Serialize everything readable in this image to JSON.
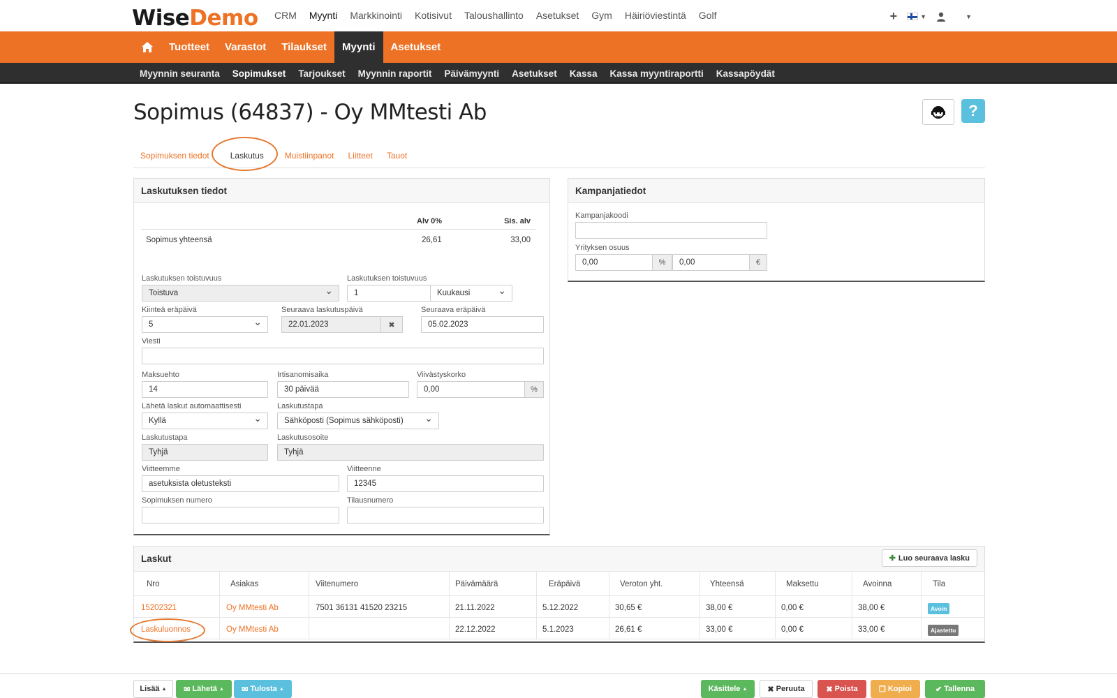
{
  "app": {
    "logo_part1": "Wise",
    "logo_part2": "Demo",
    "brand_color": "#ee7225"
  },
  "top_nav": [
    "CRM",
    "Myynti",
    "Markkinointi",
    "Kotisivut",
    "Taloushallinto",
    "Asetukset",
    "Gym",
    "Häiriöviestintä",
    "Golf"
  ],
  "top_nav_active": "Myynti",
  "main_nav": {
    "items": [
      "Tuotteet",
      "Varastot",
      "Tilaukset",
      "Myynti",
      "Asetukset"
    ],
    "active": "Myynti"
  },
  "sub_nav": {
    "items": [
      "Myynnin seuranta",
      "Sopimukset",
      "Tarjoukset",
      "Myynnin raportit",
      "Päivämyynti",
      "Asetukset",
      "Kassa",
      "Kassa myyntiraportti",
      "Kassapöydät"
    ],
    "active": "Sopimukset"
  },
  "page_title": "Sopimus (64837) - Oy MMtesti Ab",
  "help_label": "?",
  "tabs": [
    "Sopimuksen tiedot",
    "Laskutus",
    "Muistiinpanot",
    "Liitteet",
    "Tauot"
  ],
  "tabs_active": "Laskutus",
  "billing_panel": {
    "title": "Laskutuksen tiedot",
    "col_excl": "Alv 0%",
    "col_incl": "Sis. alv",
    "total_label": "Sopimus yhteensä",
    "total_excl": "26,61",
    "total_incl": "33,00",
    "recurrence_label": "Laskutuksen toistuvuus",
    "recurrence_value": "Toistuva",
    "recurrence2_label": "Laskutuksen toistuvuus",
    "recurrence_count": "1",
    "recurrence_unit": "Kuukausi",
    "fixed_due_label": "Kiinteä eräpäivä",
    "fixed_due_value": "5",
    "next_billing_label": "Seuraava laskutuspäivä",
    "next_billing_value": "22.01.2023",
    "next_due_label": "Seuraava eräpäivä",
    "next_due_value": "05.02.2023",
    "message_label": "Viesti",
    "message_value": "",
    "payment_terms_label": "Maksuehto",
    "payment_terms_value": "14",
    "notice_label": "Irtisanomisaika",
    "notice_value": "30 päivää",
    "interest_label": "Viivästyskorko",
    "interest_value": "0,00",
    "interest_unit": "%",
    "auto_send_label": "Lähetä laskut automaattisesti",
    "auto_send_value": "Kyllä",
    "method_label": "Laskutustapa",
    "method_value": "Sähköposti (Sopimus sähköposti)",
    "method2_label": "Laskutustapa",
    "method2_value": "Tyhjä",
    "address_label": "Laskutusosoite",
    "address_value": "Tyhjä",
    "our_ref_label": "Viitteemme",
    "our_ref_value": "asetuksista oletusteksti",
    "your_ref_label": "Viitteenne",
    "your_ref_value": "12345",
    "contract_no_label": "Sopimuksen numero",
    "contract_no_value": "",
    "order_no_label": "Tilausnumero",
    "order_no_value": ""
  },
  "campaign_panel": {
    "title": "Kampanjatiedot",
    "code_label": "Kampanjakoodi",
    "code_value": "",
    "company_share_label": "Yrityksen osuus",
    "share_percent": "0,00",
    "percent_unit": "%",
    "share_amount": "0,00",
    "currency_unit": "€"
  },
  "invoices": {
    "title": "Laskut",
    "new_button": "Luo seuraava lasku",
    "columns": [
      "Nro",
      "Asiakas",
      "Viitenumero",
      "Päivämäärä",
      "Eräpäivä",
      "Veroton yht.",
      "Yhteensä",
      "Maksettu",
      "Avoinna",
      "Tila"
    ],
    "rows": [
      {
        "nro": "15202321",
        "customer": "Oy MMtesti Ab",
        "ref": "7501 36131 41520 23215",
        "date": "21.11.2022",
        "due": "5.12.2022",
        "net": "30,65 €",
        "total": "38,00 €",
        "paid": "0,00 €",
        "open": "38,00 €",
        "status": "Avoin"
      },
      {
        "nro": "Laskuluonnos",
        "customer": "Oy MMtesti Ab",
        "ref": "",
        "date": "22.12.2022",
        "due": "5.1.2023",
        "net": "26,61 €",
        "total": "33,00 €",
        "paid": "0,00 €",
        "open": "33,00 €",
        "status": "Ajastettu"
      }
    ]
  },
  "footer": {
    "more": "Lisää",
    "send": "Lähetä",
    "print": "Tulosta",
    "process": "Käsittele",
    "cancel": "Peruuta",
    "delete": "Poista",
    "copy": "Kopioi",
    "save": "Tallenna"
  }
}
